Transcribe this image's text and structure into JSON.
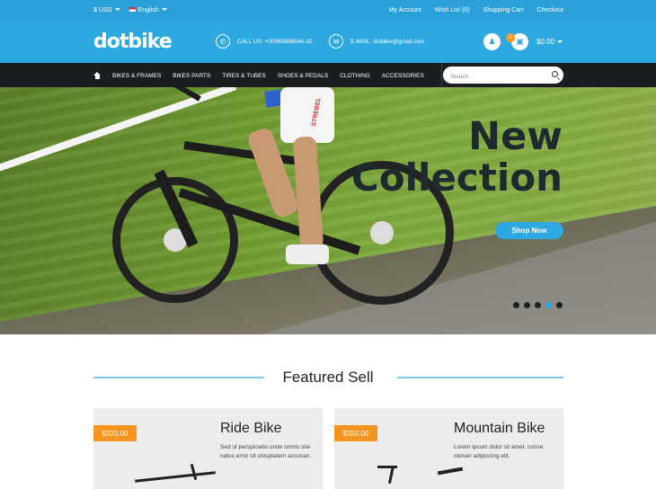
{
  "topbar": {
    "currency": "$ USD",
    "language": "English",
    "links": [
      "My Account",
      "Wish List (0)",
      "Shopping Cart",
      "Checkout"
    ]
  },
  "header": {
    "logo": "dotbike",
    "phone": "CALL US: +00965888546-32",
    "email": "E-MAIL: dotbike@gmail.com",
    "cart_count": "0",
    "cart_total": "$0.00"
  },
  "nav": {
    "items": [
      "BIKES & FRAMES",
      "BIKES PARTS",
      "TIRES & TUBES",
      "SHOES & PEDALS",
      "CLOTHING",
      "ACCESSORIES"
    ],
    "search_placeholder": "Search"
  },
  "hero": {
    "title_line1": "New",
    "title_line2": "Collection",
    "jersey_text": "STREBEL",
    "button": "Shop Now",
    "slide_count": 5,
    "active_slide": 4
  },
  "featured": {
    "title": "Featured Sell",
    "products": [
      {
        "price": "$320.00",
        "name": "Ride Bike",
        "desc": "Sed ut perspiciatis unde omnis iste natus error sit voluptatem accusan."
      },
      {
        "price": "$350.00",
        "name": "Mountain Bike",
        "desc": "Lorem ipsum dolor sit amet, conse ctetuer adipiscing elit."
      }
    ]
  },
  "colors": {
    "topbar": "#2b9fd8",
    "header": "#2ea8e0",
    "nav": "#1a1d22",
    "accent_orange": "#f7941d"
  }
}
